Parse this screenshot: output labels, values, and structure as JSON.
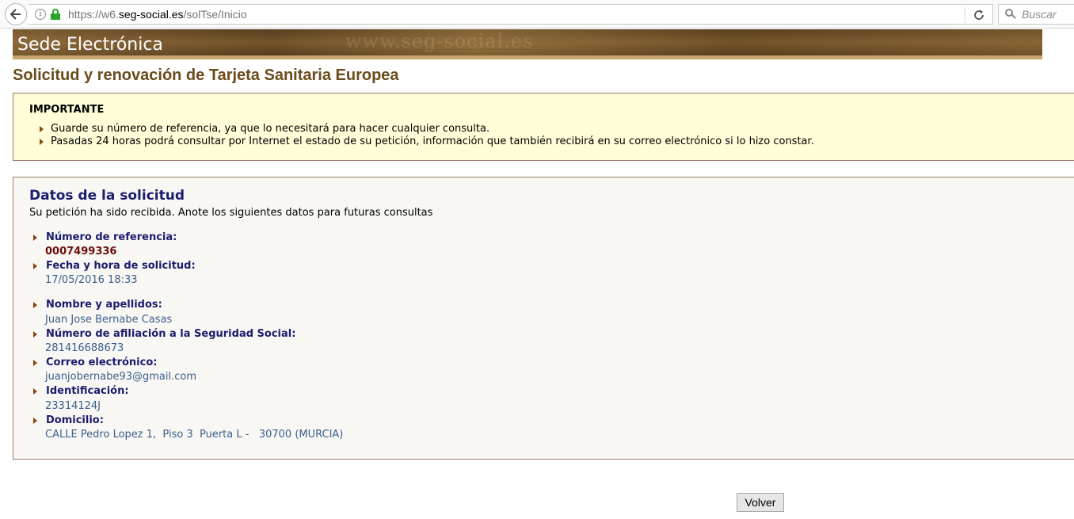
{
  "browser": {
    "url_scheme": "https://w6.",
    "url_host": "seg-social.es",
    "url_path": "/solTse/Inicio",
    "search_placeholder": "Buscar"
  },
  "header": {
    "site_title": "Sede Electrónica",
    "watermark": "www.seg-social.es"
  },
  "page": {
    "title": "Solicitud y renovación de Tarjeta Sanitaria Europea"
  },
  "important": {
    "heading": "IMPORTANTE",
    "items": [
      "Guarde su número de referencia, ya que lo necesitará para hacer cualquier consulta.",
      "Pasadas 24 horas podrá consultar por Internet el estado de su petición, información que también recibirá en su correo electrónico si lo hizo constar."
    ]
  },
  "request": {
    "title": "Datos de la solicitud",
    "intro": "Su petición ha sido recibida. Anote los siguientes datos para futuras consultas",
    "fields": [
      {
        "label": "Número de referencia:",
        "value": "0007499336"
      },
      {
        "label": "Fecha y hora de solicitud:",
        "value": "17/05/2016 18:33"
      },
      {
        "label": "Nombre y apellidos:",
        "value": "Juan Jose Bernabe Casas"
      },
      {
        "label": "Número de afiliación a la Seguridad Social:",
        "value": "281416688673"
      },
      {
        "label": "Correo electrónico:",
        "value": "juanjobernabe93@gmail.com"
      },
      {
        "label": "Identificación:",
        "value": "23314124J"
      },
      {
        "label": "Domicilio:",
        "value": "CALLE Pedro Lopez 1,  Piso 3  Puerta L -   30700 (MURCIA)"
      }
    ]
  },
  "actions": {
    "back_label": "Volver"
  }
}
